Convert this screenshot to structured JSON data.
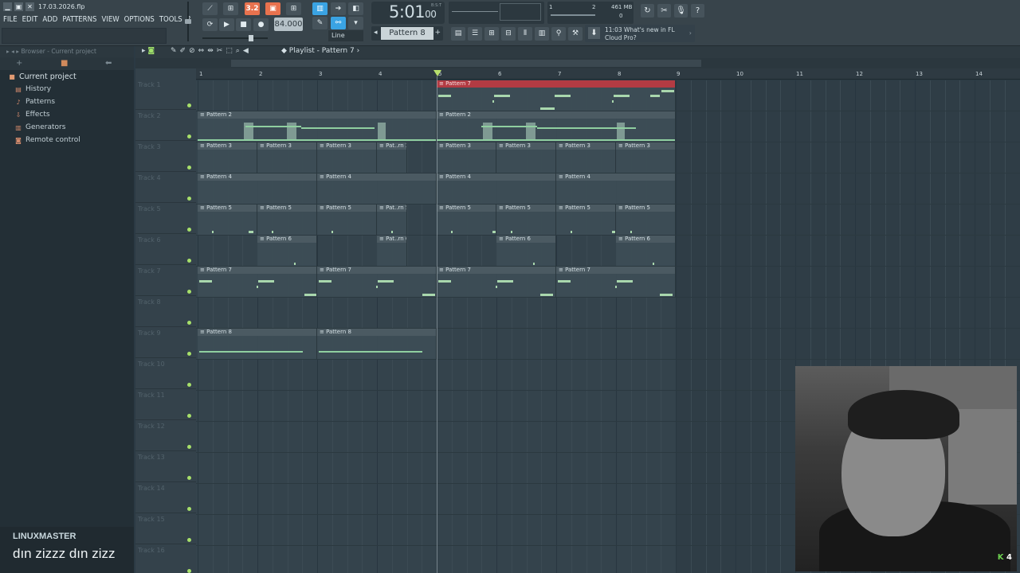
{
  "window": {
    "filename": "17.03.2026.flp",
    "buttons": [
      "▁",
      "▣",
      "✕"
    ]
  },
  "menu": [
    "FILE",
    "EDIT",
    "ADD",
    "PATTERNS",
    "VIEW",
    "OPTIONS",
    "TOOLS",
    "?"
  ],
  "transport": {
    "time": "5:01",
    "time_small": "00",
    "time_label": "B:S:T",
    "tempo": "84.000",
    "pattern": "Pattern 8",
    "snap": "Line",
    "counter_label": "3.2"
  },
  "cpu": {
    "memory": "461 MB",
    "left": "1",
    "mid": "2",
    "voices": "0"
  },
  "news": {
    "time": "11:03",
    "line1": "What's new in FL",
    "line2": "Cloud Pro?"
  },
  "browser": {
    "header": "Browser - Current project",
    "root": "Current project",
    "items": [
      "History",
      "Patterns",
      "Effects",
      "Generators",
      "Remote control"
    ]
  },
  "playlist": {
    "title": "Playlist - Pattern 7",
    "bars": [
      "1",
      "2",
      "3",
      "4",
      "5",
      "6",
      "7",
      "8",
      "9",
      "10",
      "11",
      "12",
      "13",
      "14"
    ],
    "tracks": [
      "Track 1",
      "Track 2",
      "Track 3",
      "Track 4",
      "Track 5",
      "Track 6",
      "Track 7",
      "Track 8",
      "Track 9",
      "Track 10",
      "Track 11",
      "Track 12",
      "Track 13",
      "Track 14",
      "Track 15",
      "Track 16"
    ],
    "clip_labels": {
      "p2": "Pattern 2",
      "p3": "Pattern 3",
      "p3s": "Pat..rn 3",
      "p4": "Pattern 4",
      "p5": "Pattern 5",
      "p5s": "Pat..rn 5",
      "p6": "Pattern 6",
      "p6s": "Pat..rn 6",
      "p7": "Pattern 7",
      "p8": "Pattern 8"
    }
  },
  "overlay": {
    "channel": "LINUXMASTER",
    "caption": "dın zizzz dın zizz",
    "badge": "4"
  }
}
